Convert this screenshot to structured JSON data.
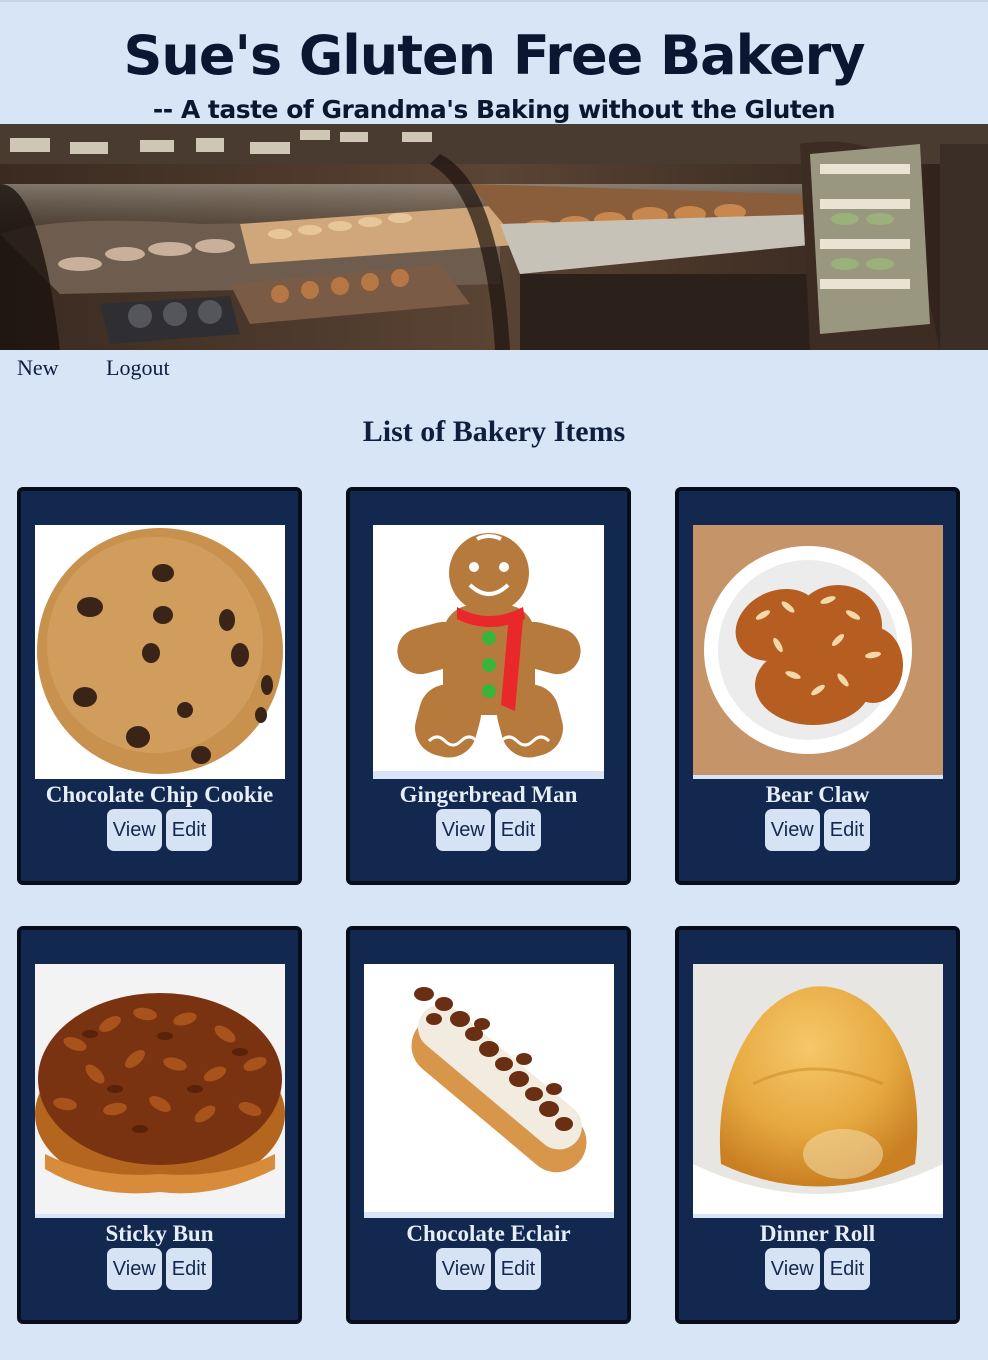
{
  "header": {
    "title": "Sue's Gluten Free Bakery",
    "tagline": "-- A taste of Grandma's Baking without the Gluten"
  },
  "banner": {
    "image": "bakery-display-case-photo"
  },
  "nav": {
    "new_label": "New",
    "logout_label": "Logout"
  },
  "main": {
    "heading": "List of Bakery Items"
  },
  "items": [
    {
      "name": "Chocolate Chip Cookie",
      "image": "chocolate-chip-cookie-photo",
      "view_label": "View",
      "edit_label": "Edit"
    },
    {
      "name": "Gingerbread Man",
      "image": "gingerbread-man-photo",
      "view_label": "View",
      "edit_label": "Edit"
    },
    {
      "name": "Bear Claw",
      "image": "bear-claw-photo",
      "view_label": "View",
      "edit_label": "Edit"
    },
    {
      "name": "Sticky Bun",
      "image": "sticky-bun-photo",
      "view_label": "View",
      "edit_label": "Edit"
    },
    {
      "name": "Chocolate Eclair",
      "image": "chocolate-eclair-photo",
      "view_label": "View",
      "edit_label": "Edit"
    },
    {
      "name": "Dinner Roll",
      "image": "dinner-roll-photo",
      "view_label": "View",
      "edit_label": "Edit"
    }
  ],
  "colors": {
    "page_background": "#d8e5f6",
    "card_background": "#13284f",
    "button_background": "#d6e3f5",
    "text_dark": "#0f1f3d"
  }
}
